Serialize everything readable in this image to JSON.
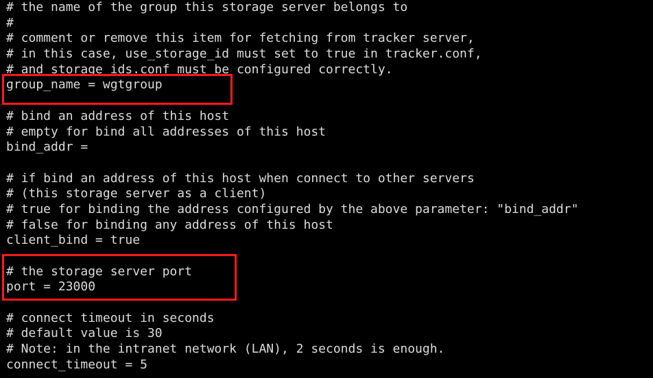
{
  "terminal": {
    "lines": [
      "# the name of the group this storage server belongs to",
      "#",
      "# comment or remove this item for fetching from tracker server,",
      "# in this case, use_storage_id must set to true in tracker.conf,",
      "# and storage_ids.conf must be configured correctly.",
      "group_name = wgtgroup",
      "",
      "# bind an address of this host",
      "# empty for bind all addresses of this host",
      "bind_addr =",
      "",
      "# if bind an address of this host when connect to other servers",
      "# (this storage server as a client)",
      "# true for binding the address configured by the above parameter: \"bind_addr\"",
      "# false for binding any address of this host",
      "client_bind = true",
      "",
      "# the storage server port",
      "port = 23000",
      "",
      "# connect timeout in seconds",
      "# default value is 30",
      "# Note: in the intranet network (LAN), 2 seconds is enough.",
      "connect_timeout = 5"
    ]
  },
  "colors": {
    "background": "#000000",
    "text": "#dcdcdc",
    "highlight_border": "#ff1a1a"
  }
}
